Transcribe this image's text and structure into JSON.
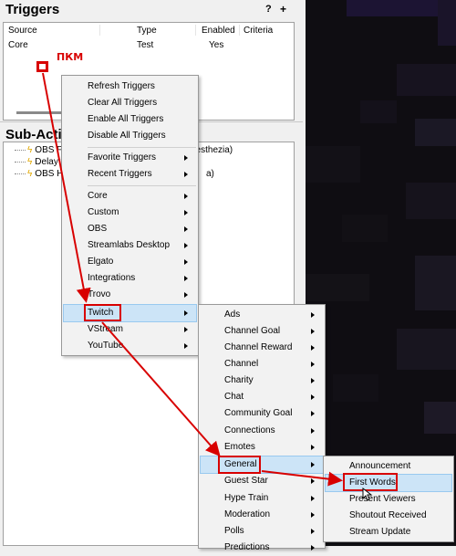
{
  "triggers": {
    "title": "Triggers",
    "help": "?",
    "add": "+",
    "columns": [
      "Source",
      "Type",
      "Enabled",
      "Criteria"
    ],
    "rows": [
      {
        "source": "Core",
        "type": "Test",
        "enabled": "Yes",
        "criteria": ""
      }
    ]
  },
  "annotation": {
    "label": "ПКМ",
    "color": "#d80000"
  },
  "subactions": {
    "title": "Sub-Acti",
    "items": [
      {
        "label": "OBS F",
        "suffix": "nesthezia)"
      },
      {
        "label": "Delay f",
        "suffix": ""
      },
      {
        "label": "OBS Hi",
        "suffix": "a)"
      }
    ]
  },
  "context_menu": {
    "items": [
      {
        "label": "Refresh Triggers",
        "submenu": false
      },
      {
        "label": "Clear All Triggers",
        "submenu": false
      },
      {
        "label": "Enable All Triggers",
        "submenu": false
      },
      {
        "label": "Disable All Triggers",
        "submenu": false
      },
      {
        "label": "Favorite Triggers",
        "submenu": true
      },
      {
        "label": "Recent Triggers",
        "submenu": true
      },
      {
        "label": "Core",
        "submenu": true
      },
      {
        "label": "Custom",
        "submenu": true
      },
      {
        "label": "OBS",
        "submenu": true
      },
      {
        "label": "Streamlabs Desktop",
        "submenu": true
      },
      {
        "label": "Elgato",
        "submenu": true
      },
      {
        "label": "Integrations",
        "submenu": true
      },
      {
        "label": "Trovo",
        "submenu": true
      },
      {
        "label": "Twitch",
        "submenu": true,
        "highlighted": true
      },
      {
        "label": "VStream",
        "submenu": true
      },
      {
        "label": "YouTube",
        "submenu": true
      }
    ]
  },
  "twitch_menu": {
    "items": [
      {
        "label": "Ads"
      },
      {
        "label": "Channel Goal"
      },
      {
        "label": "Channel Reward"
      },
      {
        "label": "Channel"
      },
      {
        "label": "Charity"
      },
      {
        "label": "Chat"
      },
      {
        "label": "Community Goal"
      },
      {
        "label": "Connections"
      },
      {
        "label": "Emotes"
      },
      {
        "label": "General",
        "highlighted": true
      },
      {
        "label": "Guest Star"
      },
      {
        "label": "Hype Train"
      },
      {
        "label": "Moderation"
      },
      {
        "label": "Polls"
      },
      {
        "label": "Predictions"
      }
    ]
  },
  "general_menu": {
    "items": [
      {
        "label": "Announcement"
      },
      {
        "label": "First Words",
        "highlighted": true
      },
      {
        "label": "Present Viewers"
      },
      {
        "label": "Shoutout Received"
      },
      {
        "label": "Stream Update"
      }
    ]
  },
  "colors": {
    "highlight_bg": "#cce4f7",
    "annotation_red": "#d80000",
    "menu_bg": "#f2f2f2"
  }
}
